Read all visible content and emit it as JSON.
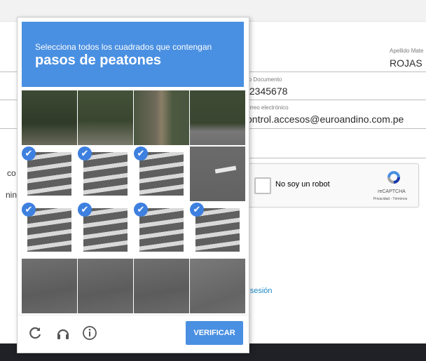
{
  "background": {
    "surname_label": "Apellido Mate",
    "surname_value": "ROJAS",
    "doc_label": "ro Documento",
    "doc_value": ".2345678",
    "email_label": "orreo electrónico",
    "email_value": "ontrol.accesos@euroandino.com.pe",
    "left_frag_1": "co",
    "left_frag_2": "nin",
    "login_link": "r sesión"
  },
  "recaptcha_embed": {
    "label": "No soy un robot",
    "brand": "reCAPTCHA",
    "terms": "Privacidad - Términos"
  },
  "challenge": {
    "instruction_line1": "Selecciona todos los cuadrados que contengan",
    "instruction_line2": "pasos de peatones",
    "verify_label": "VERIFICAR",
    "colors": {
      "header": "#4a90e2",
      "check": "#3e80e0"
    },
    "tiles": [
      {
        "id": "r1c1",
        "selected": false,
        "scene": "trees-sign"
      },
      {
        "id": "r1c2",
        "selected": false,
        "scene": "trees"
      },
      {
        "id": "r1c3",
        "selected": false,
        "scene": "tree-trunk"
      },
      {
        "id": "r1c4",
        "selected": false,
        "scene": "trees-road"
      },
      {
        "id": "r2c1",
        "selected": true,
        "scene": "crosswalk"
      },
      {
        "id": "r2c2",
        "selected": true,
        "scene": "crosswalk"
      },
      {
        "id": "r2c3",
        "selected": true,
        "scene": "crosswalk"
      },
      {
        "id": "r2c4",
        "selected": false,
        "scene": "road-arrow"
      },
      {
        "id": "r3c1",
        "selected": true,
        "scene": "crosswalk"
      },
      {
        "id": "r3c2",
        "selected": true,
        "scene": "crosswalk"
      },
      {
        "id": "r3c3",
        "selected": true,
        "scene": "crosswalk"
      },
      {
        "id": "r3c4",
        "selected": true,
        "scene": "crosswalk"
      },
      {
        "id": "r4c1",
        "selected": false,
        "scene": "asphalt"
      },
      {
        "id": "r4c2",
        "selected": false,
        "scene": "asphalt"
      },
      {
        "id": "r4c3",
        "selected": false,
        "scene": "asphalt"
      },
      {
        "id": "r4c4",
        "selected": false,
        "scene": "asphalt-crack"
      }
    ]
  }
}
